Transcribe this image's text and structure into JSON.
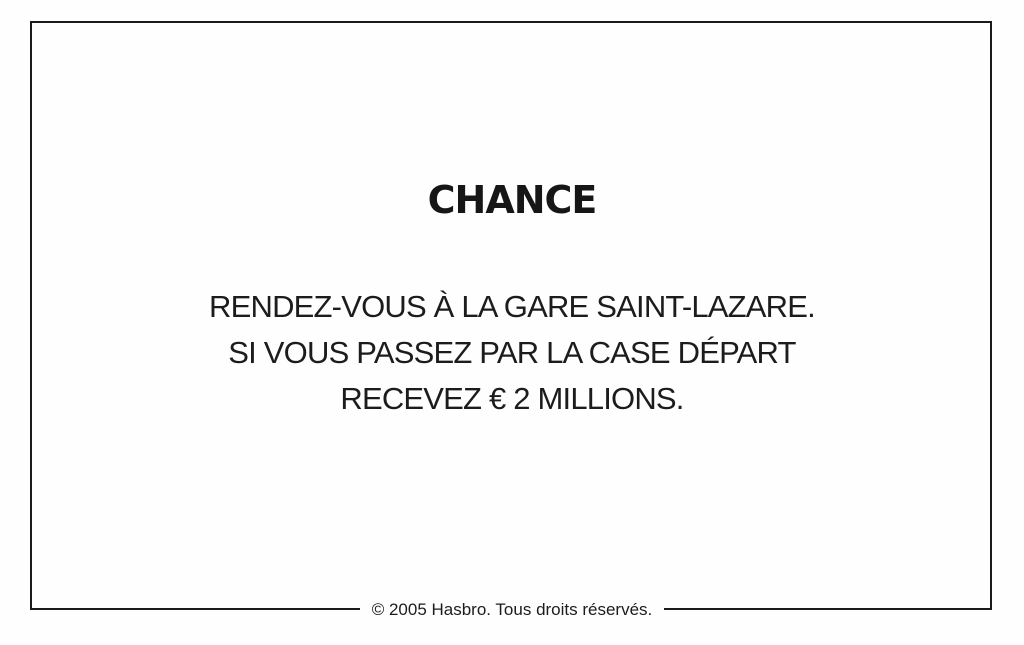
{
  "card": {
    "title": "CHANCE",
    "lines": [
      "RENDEZ-VOUS À LA GARE SAINT-LAZARE.",
      "SI VOUS PASSEZ PAR LA CASE DÉPART",
      "RECEVEZ € 2 MILLIONS."
    ],
    "footer": "© 2005 Hasbro. Tous droits réservés."
  },
  "colors": {
    "background": "#fefefe",
    "ink": "#1a1a1a"
  }
}
